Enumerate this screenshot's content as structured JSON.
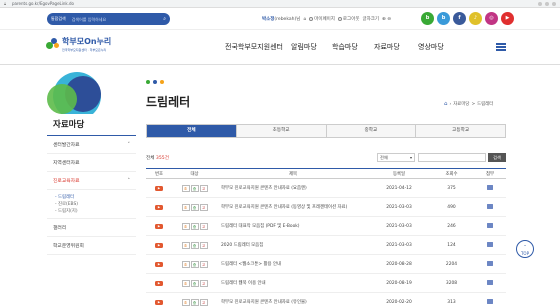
{
  "browser": {
    "url": "parents.go.kr/EgovPageLink.do"
  },
  "util": {
    "search_scope": "통합검색",
    "search_placeholder": "검색어를 입력하세요",
    "user_name": "박소정",
    "user_id": "(rebekah)",
    "user_suffix": "님",
    "mypage": "마이페이지",
    "logout": "로그아웃",
    "text_size": "글자크기",
    "social": [
      {
        "label": "b",
        "color": "#39a935"
      },
      {
        "label": "b",
        "color": "#3a9ad9"
      },
      {
        "label": "f",
        "color": "#3a5a9a"
      },
      {
        "label": "♪",
        "color": "#e0c12a"
      },
      {
        "label": "◎",
        "color": "#c13584"
      },
      {
        "label": "▶",
        "color": "#e02f2f"
      }
    ]
  },
  "header": {
    "logo_main": "학부모On누리",
    "logo_sub": "전국학부모지원센터 · 학부모온누리",
    "nav": [
      "전국학부모지원센터",
      "알림마당",
      "학습마당",
      "자료마당",
      "영상마당"
    ]
  },
  "sidebar": {
    "title": "자료마당",
    "items": [
      {
        "label": "센터발간자료",
        "chev": "˅",
        "active": false
      },
      {
        "label": "지역센터자료",
        "chev": "",
        "active": false
      },
      {
        "label": "진로교육자료",
        "chev": "˄",
        "active": true
      }
    ],
    "subitems": [
      {
        "label": "- 드림레터",
        "on": true
      },
      {
        "label": "- 진로(EBS)",
        "on": false
      },
      {
        "label": "- 드림지(지)",
        "on": false
      }
    ],
    "items2": [
      {
        "label": "갤러리"
      },
      {
        "label": "학교운영위원회"
      }
    ]
  },
  "main": {
    "title": "드림레터",
    "breadcrumb": [
      "자료마당",
      ">",
      "드림레터"
    ],
    "tabs": [
      "전체",
      "초등학교",
      "중학교",
      "고등학교"
    ],
    "count_prefix": "전체",
    "count_value": "355건",
    "filter_select": "전체",
    "search_button": "검색",
    "columns": [
      "번호",
      "대상",
      "제목",
      "등록일",
      "조회수",
      "첨부"
    ],
    "chips": [
      "초",
      "중",
      "고"
    ],
    "rows": [
      {
        "title": "학부모 진로교육지원 콘텐츠 안내자료 (요즘엔)",
        "date": "2021-04-12",
        "views": "375"
      },
      {
        "title": "학부모 진로교육지원 콘텐츠 안내자료 (동영상 및 프레젠테이션 자료)",
        "date": "2021-03-03",
        "views": "490"
      },
      {
        "title": "드림레터 대표작 모음집 (PDF 및 E-Book)",
        "date": "2021-03-03",
        "views": "246"
      },
      {
        "title": "2020 드림레터 모음집",
        "date": "2021-03-03",
        "views": "124"
      },
      {
        "title": "드림레터 <웹소크툰> 활용 안내",
        "date": "2020-08-28",
        "views": "2204"
      },
      {
        "title": "드림레터 웹북 이용 안내",
        "date": "2020-08-19",
        "views": "3208"
      },
      {
        "title": "학부모 진로교육지원 콘텐츠 안내자료 (유인물)",
        "date": "2020-02-20",
        "views": "313"
      }
    ]
  },
  "top_button": "TOP"
}
